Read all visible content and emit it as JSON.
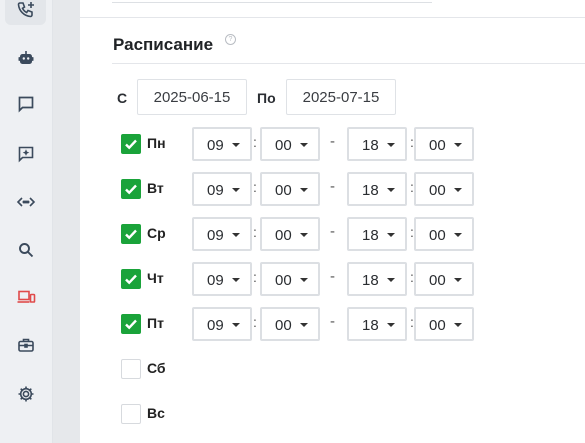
{
  "sidebar": {
    "icons": [
      "phone-add-icon",
      "bot-icon",
      "chat-icon",
      "ai-sparkle-icon",
      "code-icon",
      "search-icon",
      "devices-icon",
      "briefcase-icon",
      "gear-icon"
    ],
    "accent": "#e04a4a"
  },
  "schedule": {
    "title": "Расписание",
    "from_label": "С",
    "from_value": "2025-06-15",
    "to_label": "По",
    "to_value": "2025-07-15",
    "time_sep": ":",
    "range_sep": "-",
    "check_color": "#1aa33a",
    "days": [
      {
        "label": "Пн",
        "checked": true,
        "start_h": "09",
        "start_m": "00",
        "end_h": "18",
        "end_m": "00"
      },
      {
        "label": "Вт",
        "checked": true,
        "start_h": "09",
        "start_m": "00",
        "end_h": "18",
        "end_m": "00"
      },
      {
        "label": "Ср",
        "checked": true,
        "start_h": "09",
        "start_m": "00",
        "end_h": "18",
        "end_m": "00"
      },
      {
        "label": "Чт",
        "checked": true,
        "start_h": "09",
        "start_m": "00",
        "end_h": "18",
        "end_m": "00"
      },
      {
        "label": "Пт",
        "checked": true,
        "start_h": "09",
        "start_m": "00",
        "end_h": "18",
        "end_m": "00"
      },
      {
        "label": "Сб",
        "checked": false
      },
      {
        "label": "Вс",
        "checked": false
      }
    ]
  }
}
